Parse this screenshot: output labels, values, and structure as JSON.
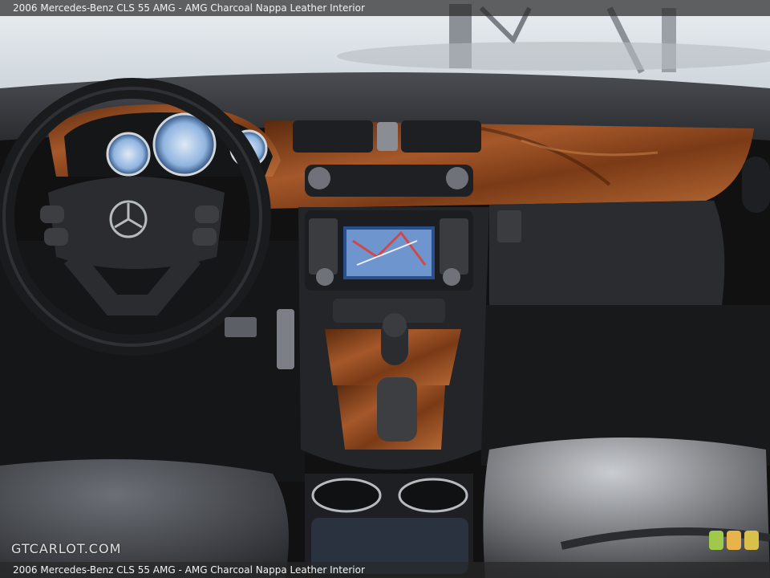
{
  "caption": {
    "top": "2006 Mercedes-Benz CLS 55 AMG - AMG Charcoal Nappa Leather Interior",
    "bottom": "2006 Mercedes-Benz CLS 55 AMG - AMG Charcoal Nappa Leather Interior"
  },
  "watermark": {
    "text": "GTCARLOT.COM"
  },
  "colors": {
    "wood": "#8a4a1f",
    "leather": "#3a3c40",
    "dash": "#2a2c30",
    "badge": [
      "#9ec94a",
      "#e8b34a",
      "#d8c04a"
    ]
  }
}
